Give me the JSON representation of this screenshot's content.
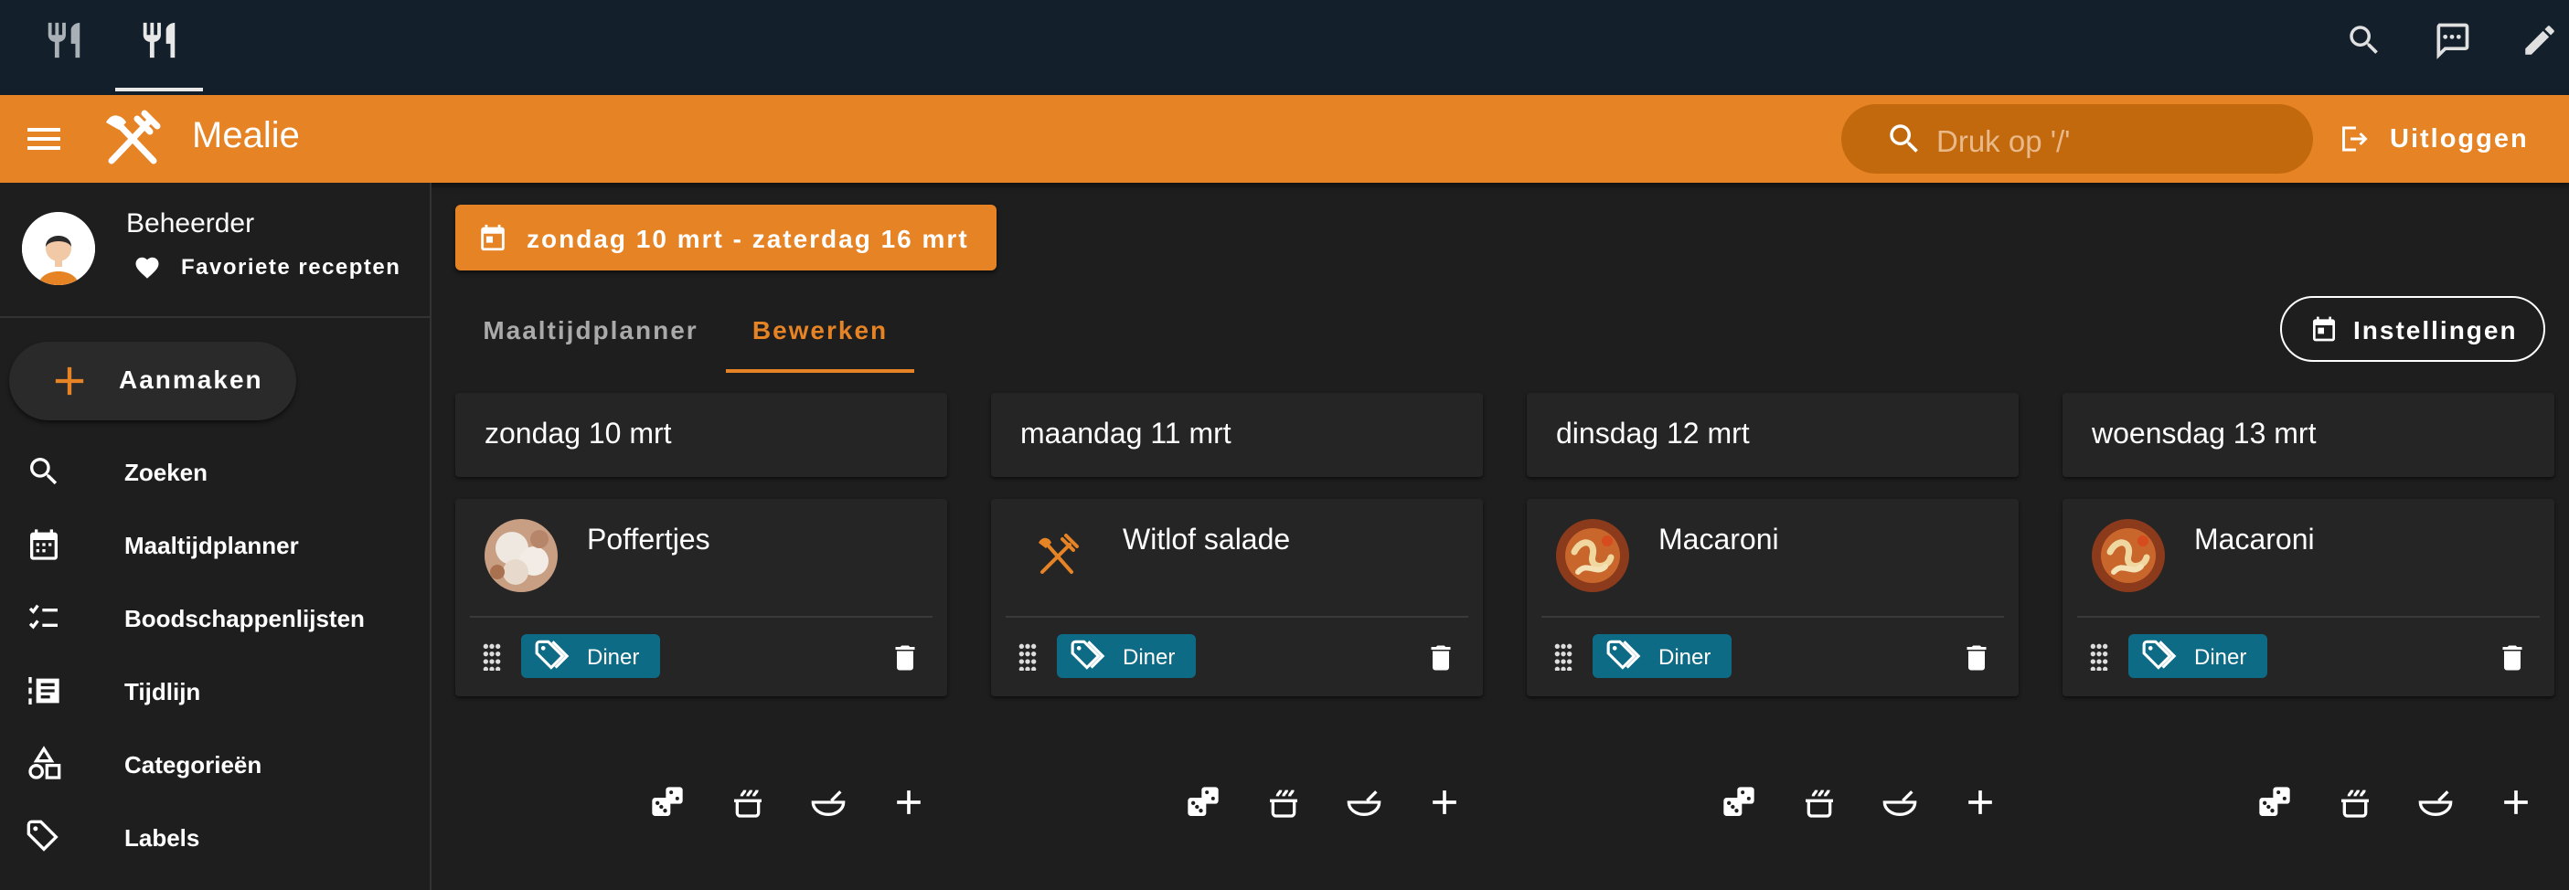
{
  "app": {
    "title": "Mealie"
  },
  "search": {
    "placeholder": "Druk op '/'"
  },
  "header": {
    "logout_label": "Uitloggen"
  },
  "user": {
    "name": "Beheerder",
    "favorites_label": "Favoriete recepten"
  },
  "sidebar": {
    "create_label": "Aanmaken",
    "items": [
      {
        "label": "Zoeken",
        "icon": "search-icon"
      },
      {
        "label": "Maaltijdplanner",
        "icon": "calendar-icon"
      },
      {
        "label": "Boodschappenlijsten",
        "icon": "checklist-icon"
      },
      {
        "label": "Tijdlijn",
        "icon": "timeline-icon"
      },
      {
        "label": "Categorieën",
        "icon": "shapes-icon"
      },
      {
        "label": "Labels",
        "icon": "tag-icon"
      }
    ]
  },
  "planner": {
    "date_range": "zondag 10 mrt - zaterdag 16 mrt",
    "tabs": [
      {
        "label": "Maaltijdplanner"
      },
      {
        "label": "Bewerken"
      }
    ],
    "settings_label": "Instellingen",
    "days": [
      {
        "title": "zondag 10 mrt",
        "meal": "Poffertjes",
        "tag": "Diner",
        "thumb": "poffertjes"
      },
      {
        "title": "maandag 11 mrt",
        "meal": "Witlof salade",
        "tag": "Diner",
        "thumb": "placeholder"
      },
      {
        "title": "dinsdag 12 mrt",
        "meal": "Macaroni",
        "tag": "Diner",
        "thumb": "macaroni"
      },
      {
        "title": "woensdag 13 mrt",
        "meal": "Macaroni",
        "tag": "Diner",
        "thumb": "macaroni"
      }
    ]
  },
  "colors": {
    "topbar": "#13202b",
    "accent": "#e58325",
    "search_bg": "#c2690d",
    "tag": "#0e6b86",
    "background": "#1e1e1e",
    "card": "#252525"
  }
}
